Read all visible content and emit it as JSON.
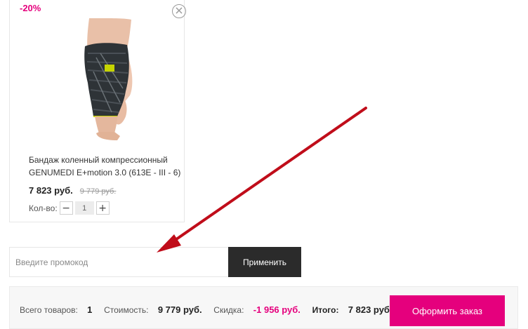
{
  "product": {
    "discount": "-20%",
    "name": "Бандаж коленный компрессионный GENUMEDI E+motion 3.0 (613E - III - 6)",
    "price": "7 823 руб.",
    "old_price": "9 779 руб.",
    "qty_label": "Кол-во:",
    "qty_minus": "−",
    "qty_value": "1",
    "qty_plus": "+"
  },
  "promo": {
    "placeholder": "Введите промокод",
    "apply_label": "Применить"
  },
  "summary": {
    "items_label": "Всего товаров:",
    "items_value": "1",
    "cost_label": "Стоимость:",
    "cost_value": "9 779 руб.",
    "discount_label": "Скидка:",
    "discount_value": "-1 956 руб.",
    "total_label": "Итого:",
    "total_value": "7 823 руб.",
    "checkout_label": "Оформить заказ"
  },
  "colors": {
    "accent": "#e5007d",
    "dark_button": "#2b2b2b",
    "annotation_arrow": "#c00d1a"
  },
  "icons": {
    "remove": "close-circle-icon",
    "annotation": "red-arrow-icon"
  }
}
